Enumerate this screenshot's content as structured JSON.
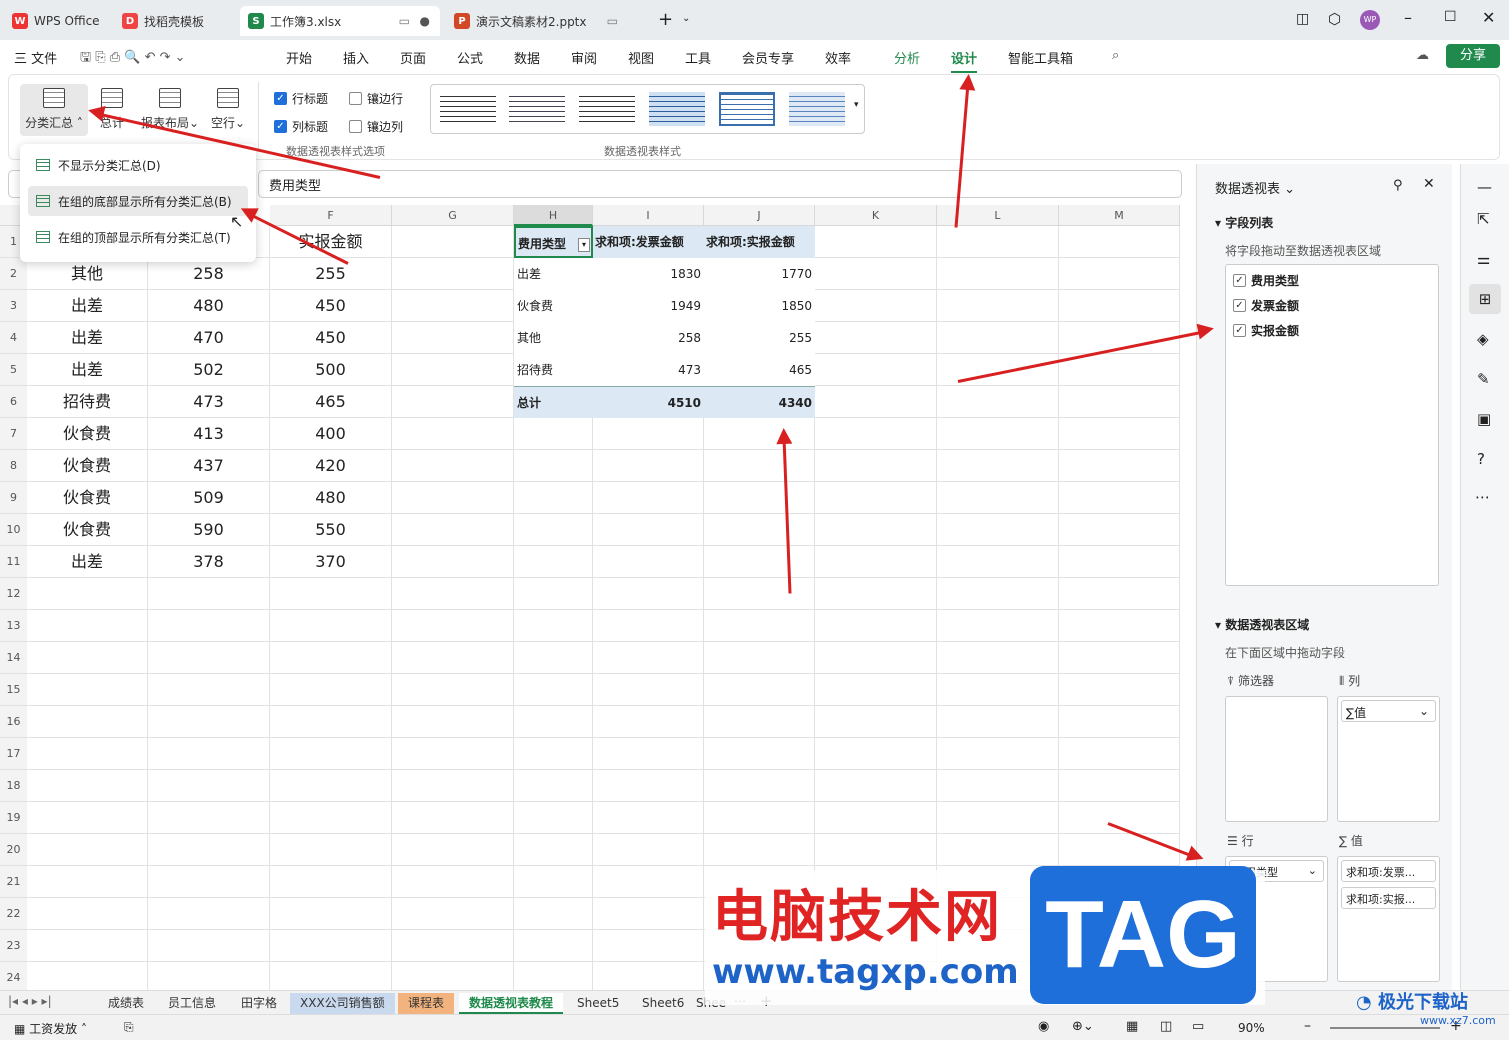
{
  "tabs": [
    {
      "label": "WPS Office",
      "badge": "W"
    },
    {
      "label": "找稻壳模板",
      "badge": "D"
    },
    {
      "label": "工作簿3.xlsx",
      "badge": "S"
    },
    {
      "label": "演示文稿素材2.pptx",
      "badge": "P"
    }
  ],
  "user_badge": "WP",
  "menu": {
    "file": "三 文件",
    "items": [
      "开始",
      "插入",
      "页面",
      "公式",
      "数据",
      "审阅",
      "视图",
      "工具",
      "会员专享",
      "效率",
      "分析",
      "设计",
      "智能工具箱"
    ],
    "share": "分享"
  },
  "ribbon": {
    "subtotal": "分类汇总",
    "total": "总计",
    "layout": "报表布局",
    "blank_rows": "空行",
    "row_header": "行标题",
    "banded_rows": "镶边行",
    "col_header": "列标题",
    "banded_cols": "镶边列",
    "group_options": "数据透视表样式选项",
    "group_styles": "数据透视表样式"
  },
  "formula_bar": {
    "value": "费用类型"
  },
  "dropdown": {
    "items": [
      "不显示分类汇总(D)",
      "在组的底部显示所有分类汇总(B)",
      "在组的顶部显示所有分类汇总(T)"
    ]
  },
  "columns": [
    "F",
    "G",
    "H",
    "I",
    "J",
    "K",
    "L",
    "M"
  ],
  "rows": [
    "1",
    "2",
    "3",
    "4",
    "5",
    "6",
    "7",
    "8",
    "9",
    "10",
    "11",
    "12",
    "13",
    "14",
    "15",
    "16",
    "17",
    "18",
    "19",
    "20",
    "21",
    "22",
    "23",
    "24"
  ],
  "data_header_f": "实报金额",
  "data_rows": [
    [
      "其他",
      "258",
      "255"
    ],
    [
      "出差",
      "480",
      "450"
    ],
    [
      "出差",
      "470",
      "450"
    ],
    [
      "出差",
      "502",
      "500"
    ],
    [
      "招待费",
      "473",
      "465"
    ],
    [
      "伙食费",
      "413",
      "400"
    ],
    [
      "伙食费",
      "437",
      "420"
    ],
    [
      "伙食费",
      "509",
      "480"
    ],
    [
      "伙食费",
      "590",
      "550"
    ],
    [
      "出差",
      "378",
      "370"
    ]
  ],
  "pivot": {
    "headers": [
      "费用类型",
      "求和项:发票金额",
      "求和项:实报金额"
    ],
    "rows": [
      [
        "出差",
        "1830",
        "1770"
      ],
      [
        "伙食费",
        "1949",
        "1850"
      ],
      [
        "其他",
        "258",
        "255"
      ],
      [
        "招待费",
        "473",
        "465"
      ]
    ],
    "total": [
      "总计",
      "4510",
      "4340"
    ]
  },
  "panel": {
    "title": "数据透视表",
    "field_list": "字段列表",
    "field_hint": "将字段拖动至数据透视表区域",
    "fields": [
      "费用类型",
      "发票金额",
      "实报金额"
    ],
    "area_title": "数据透视表区域",
    "area_hint": "在下面区域中拖动字段",
    "filter": "筛选器",
    "column": "列",
    "row": "行",
    "value": "值",
    "col_value": "∑值",
    "row_field": "费用类型",
    "value_fields": [
      "求和项:发票...",
      "求和项:实报..."
    ]
  },
  "sheets": [
    "成绩表",
    "员工信息",
    "田字格",
    "XXX公司销售额",
    "课程表",
    "数据透视表教程",
    "Sheet5",
    "Sheet6",
    "Shee"
  ],
  "status": {
    "left": "工资发放",
    "zoom": "90%"
  },
  "watermark": {
    "line1": "电脑技术网",
    "line2": "www.tagxp.com",
    "tag": "TAG",
    "corner": "极光下载站",
    "corner2": "www.xz7.com"
  }
}
